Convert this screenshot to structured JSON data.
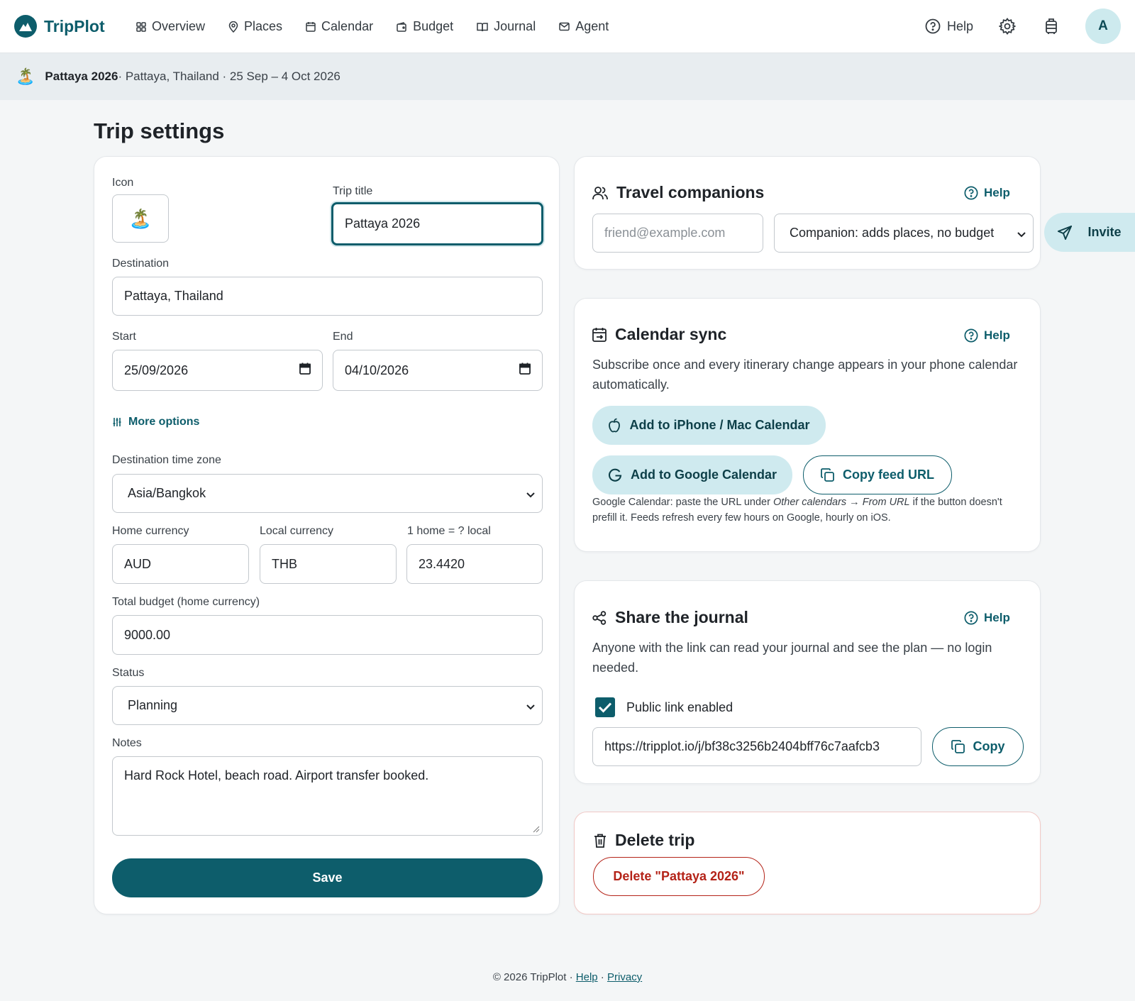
{
  "app": {
    "name": "TripPlot"
  },
  "nav": {
    "items": [
      {
        "label": "Overview",
        "icon": "grid-icon"
      },
      {
        "label": "Places",
        "icon": "map-pin-icon"
      },
      {
        "label": "Calendar",
        "icon": "calendar-icon"
      },
      {
        "label": "Budget",
        "icon": "wallet-icon"
      },
      {
        "label": "Journal",
        "icon": "book-icon"
      },
      {
        "label": "Agent",
        "icon": "mail-icon"
      }
    ],
    "help_label": "Help",
    "avatar_initial": "A"
  },
  "trip_bar": {
    "emoji": "🏝️",
    "name": "Pattaya 2026",
    "details": " · Pattaya, Thailand · 25 Sep – 4 Oct 2026"
  },
  "page": {
    "title": "Trip settings"
  },
  "settings_form": {
    "icon_label": "Icon",
    "icon_value": "🏝️",
    "title_label": "Trip title",
    "title_value": "Pattaya 2026",
    "destination_label": "Destination",
    "destination_value": "Pattaya, Thailand",
    "start_label": "Start",
    "start_value": "25/09/2026",
    "end_label": "End",
    "end_value": "04/10/2026",
    "more_options_label": "More options",
    "timezone_label": "Destination time zone",
    "timezone_value": "Asia/Bangkok",
    "home_currency_label": "Home currency",
    "home_currency_value": "AUD",
    "local_currency_label": "Local currency",
    "local_currency_value": "THB",
    "rate_label": "1 home = ? local",
    "rate_value": "23.4420",
    "budget_label": "Total budget (home currency)",
    "budget_value": "9000.00",
    "status_label": "Status",
    "status_value": "Planning",
    "notes_label": "Notes",
    "notes_value": "Hard Rock Hotel, beach road. Airport transfer booked.",
    "save_label": "Save"
  },
  "companions": {
    "title": "Travel companions",
    "help_label": "Help",
    "email_placeholder": "friend@example.com",
    "role_value": "Companion: adds places, no budget",
    "invite_label": "Invite"
  },
  "calendar_sync": {
    "title": "Calendar sync",
    "help_label": "Help",
    "description": "Subscribe once and every itinerary change appears in your phone calendar automatically.",
    "apple_button": "Add to iPhone / Mac Calendar",
    "google_button": "Add to Google Calendar",
    "copy_feed_button": "Copy feed URL",
    "note_prefix": "Google Calendar: paste the URL under ",
    "note_italic_1": "Other calendars",
    "note_arrow": " → ",
    "note_italic_2": "From URL",
    "note_suffix": " if the button doesn't prefill it. Feeds refresh every few hours on Google, hourly on iOS."
  },
  "share_journal": {
    "title": "Share the journal",
    "help_label": "Help",
    "description": "Anyone with the link can read your journal and see the plan — no login needed.",
    "checkbox_label": "Public link enabled",
    "checkbox_checked": true,
    "link_value": "https://tripplot.io/j/bf38c3256b2404bff76c7aafcb3",
    "copy_label": "Copy"
  },
  "delete_trip": {
    "title": "Delete trip",
    "button_label": "Delete \"Pattaya 2026\""
  },
  "footer": {
    "copyright": "© 2026 TripPlot · ",
    "help_link": "Help",
    "separator": " · ",
    "privacy_link": "Privacy"
  },
  "colors": {
    "brand": "#0d5d6b",
    "soft_button": "#cfeaef",
    "danger": "#b42318",
    "page_bg": "#f4f6f7"
  }
}
